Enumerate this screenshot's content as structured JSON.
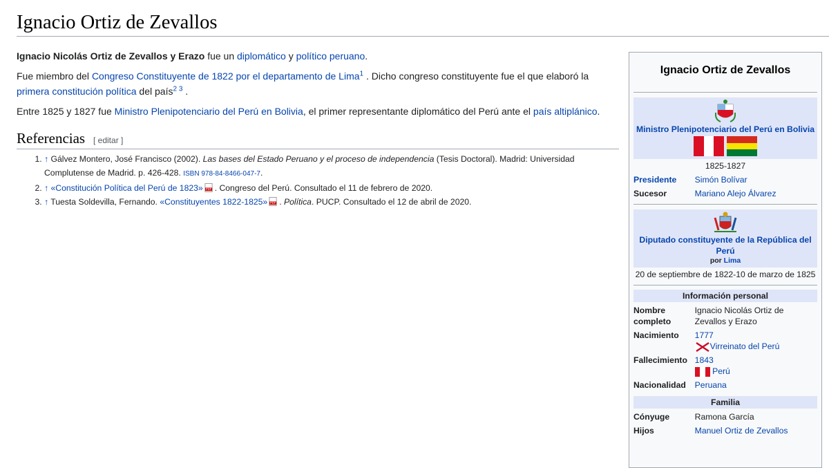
{
  "page": {
    "title": "Ignacio Ortiz de Zevallos"
  },
  "intro": {
    "p1": {
      "bold": "Ignacio Nicolás Ortiz de Zevallos y Erazo",
      "t1": " fue un ",
      "link1": "diplomático",
      "t2": " y ",
      "link2": "político",
      "t3": " ",
      "link3": "peruano",
      "t4": "."
    },
    "p2": {
      "t1": "Fue miembro del ",
      "link1": "Congreso Constituyente de 1822 por el departamento de Lima",
      "sup1": "1",
      "t2": " . Dicho congreso constituyente fue el que elaboró la ",
      "link2": "primera constitución política",
      "t3": " del país",
      "sup2": "2",
      "sup3": "3",
      "t4": " ."
    },
    "p3": {
      "t1": "Entre 1825 y 1827 fue ",
      "link1": "Ministro Plenipotenciario del Perú en Bolivia",
      "t2": ", el primer representante diplomático del Perú ante el ",
      "link2": "país altiplánico",
      "t3": "."
    }
  },
  "references": {
    "heading": "Referencias",
    "edit": "[ editar ]",
    "items": [
      {
        "arrow": "↑",
        "t1": " Gálvez Montero, José Francisco (2002). ",
        "italic": "Las bases del Estado Peruano y el proceso de independencia",
        "t2": " (Tesis Doctoral). Madrid: Universidad Complutense de Madrid. p. 426-428. ",
        "isbn": "ISBN 978-84-8466-047-7",
        "t3": "."
      },
      {
        "arrow": "↑",
        "link": "«Constitución Política del Perú de 1823»",
        "t1": ". Congreso del Perú. Consultado el 11 de febrero de 2020."
      },
      {
        "arrow": "↑",
        "t1": " Tuesta Soldevilla, Fernando. ",
        "link": "«Constituyentes 1822-1825»",
        "t2": ". ",
        "italic": "Política",
        "t3": ". PUCP. Consultado el 12 de abril de 2020."
      }
    ]
  },
  "infobox": {
    "title": "Ignacio Ortiz de Zevallos",
    "office1": {
      "name": "Ministro Plenipotenciario del Perú en Bolivia",
      "dates": "1825-1827",
      "rows": [
        {
          "label": "Presidente",
          "value": "Simón Bolívar"
        },
        {
          "label": "Sucesor",
          "value": "Mariano Alejo Álvarez"
        }
      ]
    },
    "office2": {
      "name": "Diputado constituyente de la República del Perú",
      "por": "por",
      "por_link": "Lima",
      "dates": "20 de septiembre de 1822-10 de marzo de 1825"
    },
    "personal": {
      "heading": "Información personal",
      "nombre_label": "Nombre completo",
      "nombre_value": "Ignacio Nicolás Ortiz de Zevallos y Erazo",
      "nac_label": "Nacimiento",
      "nac_year": "1777",
      "nac_place": "Virreinato del Perú",
      "fall_label": "Fallecimiento",
      "fall_year": "1843",
      "fall_place": "Perú",
      "nacio_label": "Nacionalidad",
      "nacio_value": "Peruana"
    },
    "familia": {
      "heading": "Familia",
      "conyuge_label": "Cónyuge",
      "conyuge_value": "Ramona García",
      "hijos_label": "Hijos",
      "hijos_value": "Manuel Ortiz de Zevallos"
    }
  },
  "colors": {
    "link": "#0645ad",
    "band": "#dfe5f8",
    "border": "#a2a9b1",
    "peru_red": "#d91023",
    "bolivia_red": "#d52b1e",
    "bolivia_yellow": "#f9e300",
    "bolivia_green": "#007934"
  },
  "icons": [
    "peru-coat-of-arms-icon",
    "peru-flag-icon",
    "bolivia-flag-icon",
    "viceroyalty-flag-icon",
    "pdf-icon"
  ]
}
